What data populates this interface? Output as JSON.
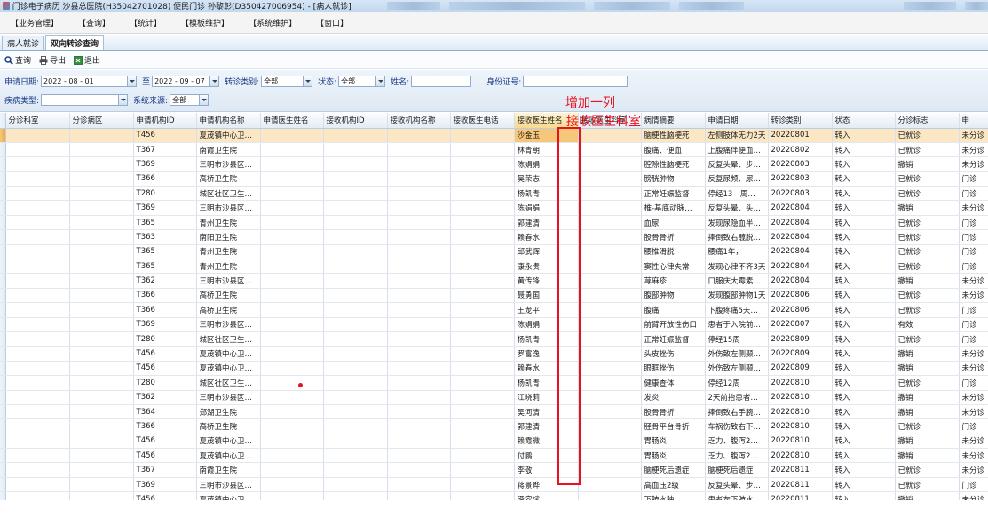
{
  "titlebar": {
    "title": "门诊电子病历 沙县总医院(H35042701028) 便民门诊 孙黎彰(D350427006954) - [病人就诊]"
  },
  "menu": [
    "【业务管理】",
    "【查询】",
    "【统计】",
    "【模板维护】",
    "【系统维护】",
    "【窗口】"
  ],
  "tabs": [
    {
      "label": "病人就诊",
      "active": false
    },
    {
      "label": "双向转诊查询",
      "active": true
    }
  ],
  "toolbar": {
    "query_label": "查询",
    "export_label": "导出",
    "exit_label": "退出"
  },
  "filters": {
    "date_label": "申请日期:",
    "date_from": "2022 - 08 - 01",
    "to_label": "至",
    "date_to": "2022 - 09 - 07",
    "referral_type_label": "转诊类别:",
    "referral_type_value": "全部",
    "status_label": "状态:",
    "status_value": "全部",
    "name_label": "姓名:",
    "name_value": "",
    "id_label": "身份证号:",
    "id_value": "",
    "disease_type_label": "疾病类型:",
    "disease_type_value": "",
    "source_label": "系统来源:",
    "source_value": "全部"
  },
  "annotation": {
    "line1": "增加一列",
    "line2": "接收医生科室"
  },
  "columns": [
    "分诊科室",
    "分诊病区",
    "申请机构ID",
    "申请机构名称",
    "申请医生姓名",
    "接收机构ID",
    "接收机构名称",
    "接收医生电话",
    "接收医生姓名",
    "接收医生科室",
    "病情摘要",
    "申请日期",
    "转诊类别",
    "状态",
    "分诊标志",
    "申"
  ],
  "rows": [
    [
      "",
      "",
      "T456",
      "夏茂镇中心卫…",
      "",
      "",
      "",
      "",
      "沙金玉",
      "",
      "脑梗性脑梗死",
      "左侧肢体无力2天",
      "20220801",
      "转入",
      "已就诊",
      "未分诊"
    ],
    [
      "",
      "",
      "T367",
      "南霞卫生院",
      "",
      "",
      "",
      "",
      "林青朝",
      "",
      "腹痛、便血",
      "上腹痛伴便血…",
      "20220802",
      "转入",
      "已就诊",
      "未分诊"
    ],
    [
      "",
      "",
      "T369",
      "三明市沙县区…",
      "",
      "",
      "",
      "",
      "陈娟娟",
      "",
      "腔隙性脑梗死",
      "反复头晕、步…",
      "20220803",
      "转入",
      "撤销",
      "未分诊"
    ],
    [
      "",
      "",
      "T366",
      "高桥卫生院",
      "",
      "",
      "",
      "",
      "吴荣志",
      "",
      "膀胱肿物",
      "反复尿频、尿…",
      "20220803",
      "转入",
      "已就诊",
      "门诊"
    ],
    [
      "",
      "",
      "T280",
      "城区社区卫生…",
      "",
      "",
      "",
      "",
      "杨凯青",
      "",
      "正常妊娠监督",
      "停经13　周…",
      "20220803",
      "转入",
      "已就诊",
      "门诊"
    ],
    [
      "",
      "",
      "T369",
      "三明市沙县区…",
      "",
      "",
      "",
      "",
      "陈娟娟",
      "",
      "椎-基底动脉…",
      "反复头晕、头…",
      "20220804",
      "转入",
      "撤销",
      "未分诊"
    ],
    [
      "",
      "",
      "T365",
      "青州卫生院",
      "",
      "",
      "",
      "",
      "郭建清",
      "",
      "血尿",
      "发现尿隐血半…",
      "20220804",
      "转入",
      "已就诊",
      "门诊"
    ],
    [
      "",
      "",
      "T363",
      "南阳卫生院",
      "",
      "",
      "",
      "",
      "赖春水",
      "",
      "股骨骨折",
      "摔倒致右髋脱…",
      "20220804",
      "转入",
      "已就诊",
      "门诊"
    ],
    [
      "",
      "",
      "T365",
      "青州卫生院",
      "",
      "",
      "",
      "",
      "邱武辉",
      "",
      "腰椎滑脱",
      "腰痛1年，",
      "20220804",
      "转入",
      "已就诊",
      "门诊"
    ],
    [
      "",
      "",
      "T365",
      "青州卫生院",
      "",
      "",
      "",
      "",
      "康永贵",
      "",
      "窦性心律失常",
      "发现心律不齐3天",
      "20220804",
      "转入",
      "已就诊",
      "门诊"
    ],
    [
      "",
      "",
      "T362",
      "三明市沙县区…",
      "",
      "",
      "",
      "",
      "黄传锋",
      "",
      "荨麻疹",
      "口服庆大霉素…",
      "20220804",
      "转入",
      "撤销",
      "未分诊"
    ],
    [
      "",
      "",
      "T366",
      "高桥卫生院",
      "",
      "",
      "",
      "",
      "聂勇国",
      "",
      "腹部肿物",
      "发现腹部肿物1天",
      "20220806",
      "转入",
      "已就诊",
      "未分诊"
    ],
    [
      "",
      "",
      "T366",
      "高桥卫生院",
      "",
      "",
      "",
      "",
      "王龙平",
      "",
      "腹痛",
      "下腹疼痛5天…",
      "20220806",
      "转入",
      "已就诊",
      "门诊"
    ],
    [
      "",
      "",
      "T369",
      "三明市沙县区…",
      "",
      "",
      "",
      "",
      "陈娟娟",
      "",
      "前臂开放性伤口",
      "患者于入院前…",
      "20220807",
      "转入",
      "有效",
      "门诊"
    ],
    [
      "",
      "",
      "T280",
      "城区社区卫生…",
      "",
      "",
      "",
      "",
      "杨凯青",
      "",
      "正常妊娠监督",
      "停经15周",
      "20220809",
      "转入",
      "已就诊",
      "门诊"
    ],
    [
      "",
      "",
      "T456",
      "夏茂镇中心卫…",
      "",
      "",
      "",
      "",
      "罗富逸",
      "",
      "头皮挫伤",
      "外伤致左侧颞…",
      "20220809",
      "转入",
      "撤销",
      "未分诊"
    ],
    [
      "",
      "",
      "T456",
      "夏茂镇中心卫…",
      "",
      "",
      "",
      "",
      "赖春水",
      "",
      "眼眶挫伤",
      "外伤致左侧颞…",
      "20220809",
      "转入",
      "撤销",
      "未分诊"
    ],
    [
      "",
      "",
      "T280",
      "城区社区卫生…",
      "",
      "",
      "",
      "",
      "杨凯青",
      "",
      "健康查体",
      "停经12周",
      "20220810",
      "转入",
      "已就诊",
      "门诊"
    ],
    [
      "",
      "",
      "T362",
      "三明市沙县区…",
      "",
      "",
      "",
      "",
      "江晓莉",
      "",
      "发炎",
      "2天前抬患者…",
      "20220810",
      "转入",
      "撤销",
      "未分诊"
    ],
    [
      "",
      "",
      "T364",
      "郑湖卫生院",
      "",
      "",
      "",
      "",
      "吴河清",
      "",
      "股骨骨折",
      "摔倒致右手腕…",
      "20220810",
      "转入",
      "撤销",
      "未分诊"
    ],
    [
      "",
      "",
      "T366",
      "高桥卫生院",
      "",
      "",
      "",
      "",
      "郭建清",
      "",
      "胫骨平台骨折",
      "车祸伤致右下…",
      "20220810",
      "转入",
      "已就诊",
      "门诊"
    ],
    [
      "",
      "",
      "T456",
      "夏茂镇中心卫…",
      "",
      "",
      "",
      "",
      "赖霞微",
      "",
      "胃肠炎",
      "乏力、腹泻2…",
      "20220810",
      "转入",
      "撤销",
      "未分诊"
    ],
    [
      "",
      "",
      "T456",
      "夏茂镇中心卫…",
      "",
      "",
      "",
      "",
      "付鹏",
      "",
      "胃肠炎",
      "乏力、腹泻2…",
      "20220810",
      "转入",
      "撤销",
      "未分诊"
    ],
    [
      "",
      "",
      "T367",
      "南霞卫生院",
      "",
      "",
      "",
      "",
      "李敬",
      "",
      "脑梗死后遗症",
      "脑梗死后遗症",
      "20220811",
      "转入",
      "已就诊",
      "未分诊"
    ],
    [
      "",
      "",
      "T369",
      "三明市沙县区…",
      "",
      "",
      "",
      "",
      "蒋景晔",
      "",
      "高血压2级",
      "反复头晕、步…",
      "20220811",
      "转入",
      "已就诊",
      "门诊"
    ],
    [
      "",
      "",
      "T456",
      "夏茂镇中心卫…",
      "",
      "",
      "",
      "",
      "泽容斌",
      "",
      "下肢水肿",
      "患者左下肢水…",
      "20220811",
      "转入",
      "撤销",
      "未分诊"
    ]
  ],
  "colors": {
    "annotation_red": "#e8111f",
    "selected_row": "#fbe7c4",
    "sorted_header": "#f7d98e"
  }
}
